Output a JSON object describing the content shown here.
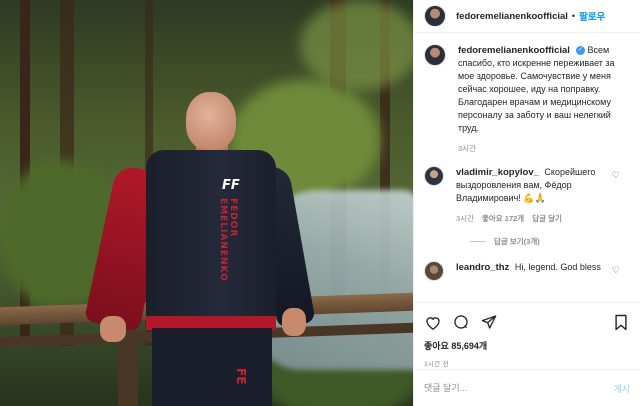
{
  "header": {
    "username": "fedoremelianenkoofficial",
    "follow_label": "팔로우",
    "separator": "•"
  },
  "caption": {
    "username": "fedoremelianenkoofficial",
    "text": "Всем спасибо, кто искренне переживает за мое здоровье. Самочувствие у меня сейчас хорошее, иду на поправку.\nБлагодарен врачам и медицинскому персоналу за заботу и ваш нелегкий труд.",
    "time": "3시간"
  },
  "comments": [
    {
      "username": "vladimir_kopylov_",
      "text": "Скорейшего выздоровления вам, Фёдор Владимирович! 💪🙏",
      "time": "3시간",
      "likes": "좋아요 172개",
      "reply_label": "답글 달기",
      "view_replies": "답글 보기(3개)"
    },
    {
      "username": "leandro_thz",
      "text": "Hi, legend. God bless"
    }
  ],
  "actions": {
    "like_icon": "heart-icon",
    "comment_icon": "comment-icon",
    "share_icon": "share-icon",
    "save_icon": "bookmark-icon"
  },
  "likes_text": "좋아요 85,694개",
  "time_ago": "3시간 전",
  "add_comment": {
    "placeholder": "댓글 달기...",
    "post_label": "게시"
  },
  "photo": {
    "jacket_logo": "FF",
    "jacket_text": "FEDOR EMELIANENKO",
    "pants_text": "FE"
  }
}
